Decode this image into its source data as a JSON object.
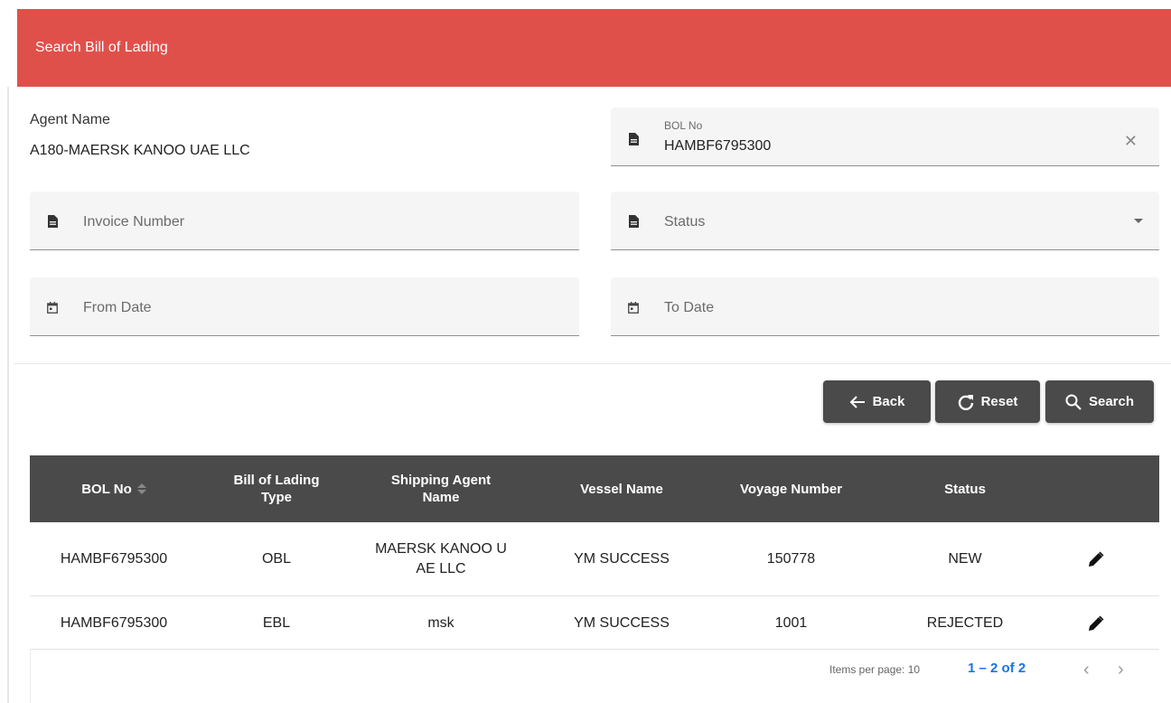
{
  "header": {
    "title": "Search Bill of Lading"
  },
  "agent": {
    "label": "Agent Name",
    "value": "A180-MAERSK KANOO UAE LLC"
  },
  "fields": {
    "bol_no": {
      "label": "BOL No",
      "value": "HAMBF6795300",
      "clear_icon": "close-icon"
    },
    "invoice_number": {
      "placeholder": "Invoice Number"
    },
    "status": {
      "placeholder": "Status"
    },
    "from_date": {
      "placeholder": "From Date"
    },
    "to_date": {
      "placeholder": "To Date"
    }
  },
  "buttons": {
    "back": "Back",
    "reset": "Reset",
    "search": "Search"
  },
  "table": {
    "headers": {
      "bol_no": "BOL No",
      "bol_type_line1": "Bill of Lading",
      "bol_type_line2": "Type",
      "agent_line1": "Shipping Agent",
      "agent_line2": "Name",
      "vessel": "Vessel Name",
      "voyage": "Voyage Number",
      "status": "Status"
    },
    "rows": [
      {
        "bol_no": "HAMBF6795300",
        "type": "OBL",
        "agent_line1": "MAERSK KANOO U",
        "agent_line2": "AE LLC",
        "vessel": "YM SUCCESS",
        "voyage": "150778",
        "status": "NEW"
      },
      {
        "bol_no": "HAMBF6795300",
        "type": "EBL",
        "agent_line1": "msk",
        "agent_line2": "",
        "vessel": "YM SUCCESS",
        "voyage": "1001",
        "status": "REJECTED"
      }
    ]
  },
  "pager": {
    "items_per_page": "Items per page: 10",
    "range": "1 – 2 of 2"
  },
  "colors": {
    "header": "#e0504b",
    "dark": "#4a4a4a",
    "link": "#1a73e8"
  }
}
